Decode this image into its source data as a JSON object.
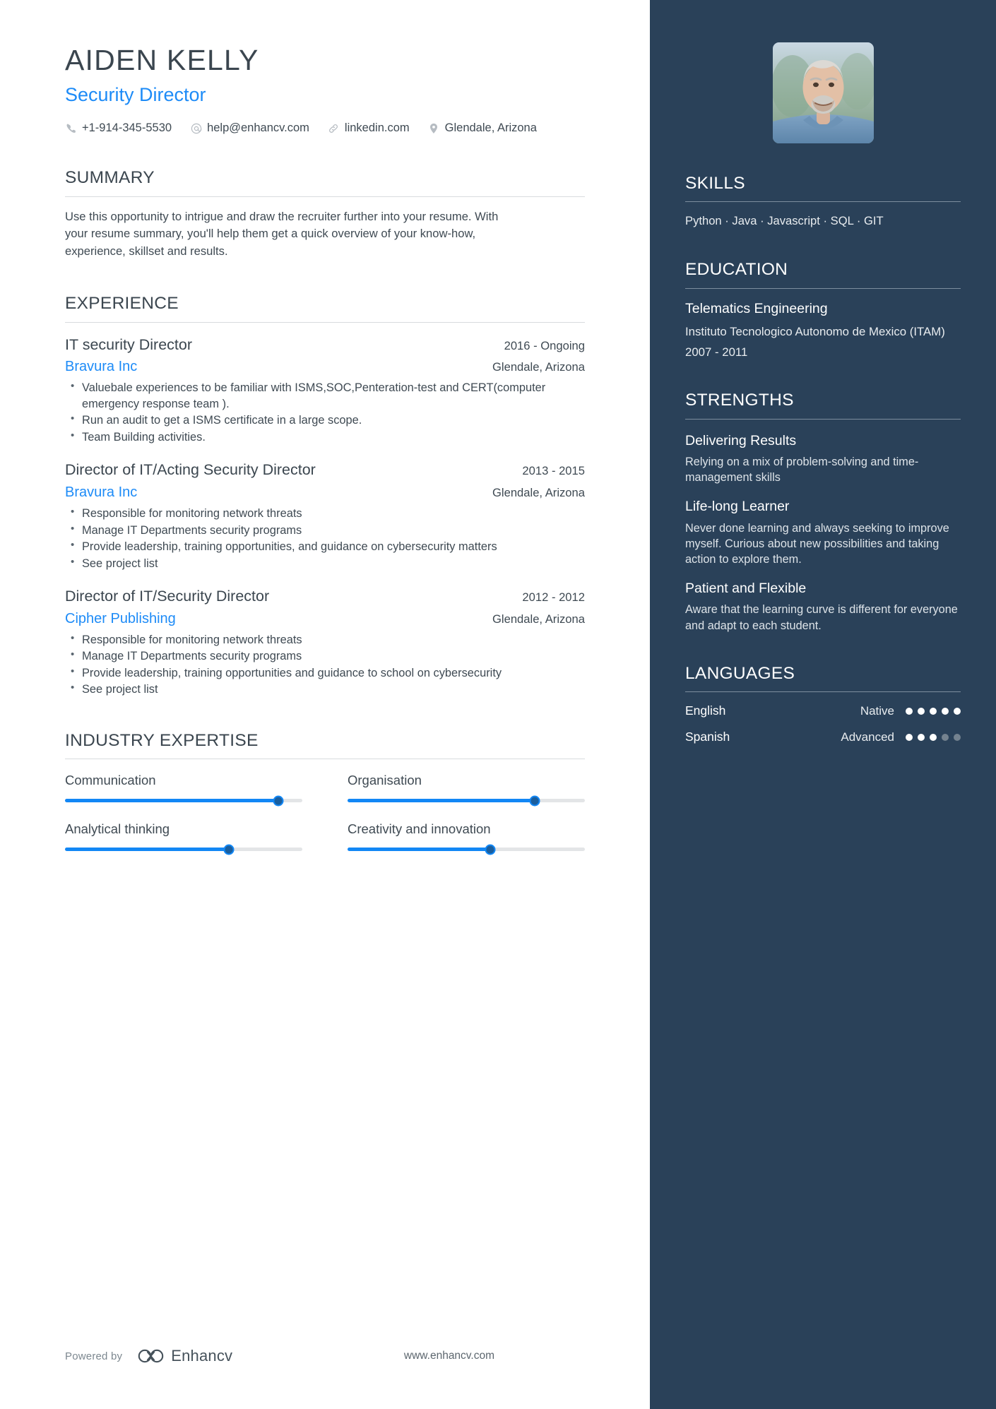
{
  "header": {
    "name": "AIDEN KELLY",
    "job_title": "Security Director",
    "accent_color": "#1d8bf7",
    "sidebar_color": "#2a4159",
    "contacts": [
      {
        "icon": "phone-icon",
        "text": "+1-914-345-5530"
      },
      {
        "icon": "email-icon",
        "text": "help@enhancv.com"
      },
      {
        "icon": "link-icon",
        "text": "linkedin.com"
      },
      {
        "icon": "location-pin-icon",
        "text": "Glendale, Arizona"
      }
    ]
  },
  "summary": {
    "title": "SUMMARY",
    "text": "Use this opportunity to intrigue and draw the recruiter further into your resume. With your resume summary, you'll help them get a quick overview of your know-how, experience, skillset and results."
  },
  "experience": {
    "title": "EXPERIENCE",
    "entries": [
      {
        "role": "IT security Director",
        "dates": "2016 - Ongoing",
        "company": "Bravura Inc",
        "location": "Glendale, Arizona",
        "bullets": [
          "Valuebale experiences to be familiar with ISMS,SOC,Penteration-test and CERT(computer emergency response team ).",
          "Run an audit to get a ISMS certificate in a  large scope.",
          "Team Building activities."
        ]
      },
      {
        "role": "Director of IT/Acting Security Director",
        "dates": "2013 - 2015",
        "company": "Bravura Inc",
        "location": "Glendale, Arizona",
        "bullets": [
          "Responsible for monitoring network threats",
          "Manage IT Departments security programs",
          "Provide leadership, training opportunities, and guidance on cybersecurity matters",
          "See project list"
        ]
      },
      {
        "role": "Director of IT/Security Director",
        "dates": "2012 - 2012",
        "company": "Cipher Publishing",
        "location": "Glendale, Arizona",
        "bullets": [
          "Responsible for monitoring network threats",
          "Manage IT Departments security programs",
          "Provide leadership, training opportunities and guidance to school on cybersecurity",
          "See project list"
        ]
      }
    ]
  },
  "industry_expertise": {
    "title": "INDUSTRY EXPERTISE",
    "items": [
      {
        "label": "Communication",
        "percent": 90
      },
      {
        "label": "Organisation",
        "percent": 79
      },
      {
        "label": "Analytical thinking",
        "percent": 69
      },
      {
        "label": "Creativity and innovation",
        "percent": 60
      }
    ]
  },
  "footer": {
    "powered_by": "Powered by",
    "brand": "Enhancv",
    "url": "www.enhancv.com"
  },
  "sidebar": {
    "skills": {
      "title": "SKILLS",
      "list": "Python · Java · Javascript · SQL · GIT"
    },
    "education": {
      "title": "EDUCATION",
      "degree": "Telematics Engineering",
      "school": "Instituto Tecnologico Autonomo de Mexico (ITAM)",
      "dates": "2007 - 2011"
    },
    "strengths": {
      "title": "STRENGTHS",
      "items": [
        {
          "title": "Delivering Results",
          "desc": "Relying on a mix of problem-solving and time-management skills"
        },
        {
          "title": "Life-long Learner",
          "desc": "Never done learning and always seeking to improve myself. Curious about new possibilities and taking action to explore them."
        },
        {
          "title": "Patient and Flexible",
          "desc": "Aware that the learning curve is different for everyone and adapt to each student."
        }
      ]
    },
    "languages": {
      "title": "LANGUAGES",
      "items": [
        {
          "name": "English",
          "level": "Native",
          "filled": 5,
          "total": 5
        },
        {
          "name": "Spanish",
          "level": "Advanced",
          "filled": 3,
          "total": 5
        }
      ]
    }
  }
}
